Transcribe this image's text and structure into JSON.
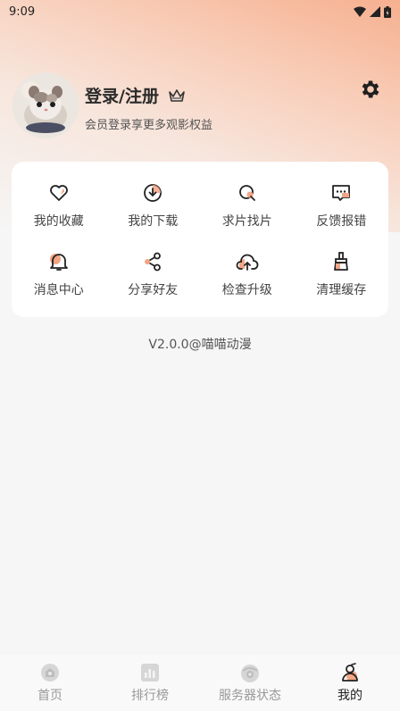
{
  "status_bar": {
    "time": "9:09"
  },
  "profile": {
    "title": "登录/注册",
    "subtitle": "会员登录享更多观影权益"
  },
  "features": [
    {
      "label": "我的收藏",
      "icon": "heart-icon"
    },
    {
      "label": "我的下载",
      "icon": "download-icon"
    },
    {
      "label": "求片找片",
      "icon": "search-film-icon"
    },
    {
      "label": "反馈报错",
      "icon": "feedback-icon"
    },
    {
      "label": "消息中心",
      "icon": "bell-icon"
    },
    {
      "label": "分享好友",
      "icon": "share-icon"
    },
    {
      "label": "检查升级",
      "icon": "cloud-upload-icon"
    },
    {
      "label": "清理缓存",
      "icon": "broom-icon"
    }
  ],
  "version": "V2.0.0@喵喵动漫",
  "bottom_nav": [
    {
      "label": "首页",
      "icon": "home-icon",
      "active": false
    },
    {
      "label": "排行榜",
      "icon": "chart-icon",
      "active": false
    },
    {
      "label": "服务器状态",
      "icon": "server-icon",
      "active": false
    },
    {
      "label": "我的",
      "icon": "profile-icon",
      "active": true
    }
  ],
  "colors": {
    "accent": "#f3a584",
    "gradient_top": "#f6b08f"
  }
}
